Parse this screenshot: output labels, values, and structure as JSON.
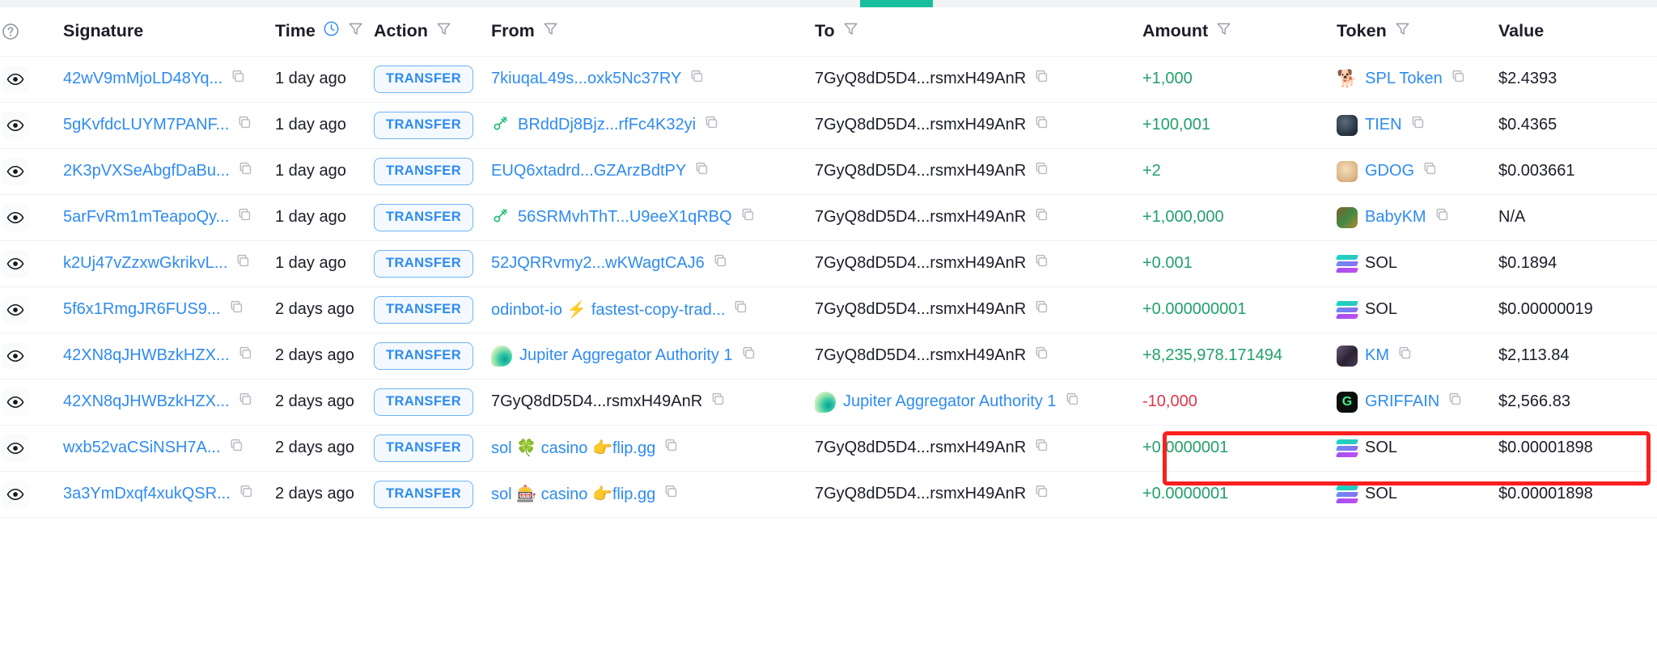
{
  "scrollbar": {
    "accent_color": "#17bf9e"
  },
  "table": {
    "columns": [
      {
        "key": "help",
        "label": "",
        "icon": "help-circle-icon",
        "filter": false
      },
      {
        "key": "signature",
        "label": "Signature",
        "filter": false
      },
      {
        "key": "time",
        "label": "Time",
        "filter": true,
        "icon": "clock-icon"
      },
      {
        "key": "action",
        "label": "Action",
        "filter": true
      },
      {
        "key": "from",
        "label": "From",
        "filter": true
      },
      {
        "key": "to",
        "label": "To",
        "filter": true
      },
      {
        "key": "amount",
        "label": "Amount",
        "filter": true
      },
      {
        "key": "token",
        "label": "Token",
        "filter": true
      },
      {
        "key": "value",
        "label": "Value",
        "filter": false
      }
    ],
    "rows": [
      {
        "signature": "42wV9mMjoLD48Yq...",
        "time": "1 day ago",
        "action": "TRANSFER",
        "from": {
          "text": "7kiuqaL49s...oxk5Nc37RY",
          "link": true,
          "icon": "none",
          "copy": true
        },
        "to": {
          "text": "7GyQ8dD5D4...rsmxH49AnR",
          "link": false,
          "icon": "none",
          "copy": true
        },
        "amount": "+1,000",
        "amount_sign": "positive",
        "token": {
          "label": "SPL Token",
          "icon": "dog-emoji",
          "copy": true,
          "link": true
        },
        "value": "$2.4393"
      },
      {
        "signature": "5gKvfdcLUYM7PANF...",
        "time": "1 day ago",
        "action": "TRANSFER",
        "from": {
          "text": "BRddDj8Bjz...rfFc4K32yi",
          "link": true,
          "icon": "green-key-icon",
          "copy": true
        },
        "to": {
          "text": "7GyQ8dD5D4...rsmxH49AnR",
          "link": false,
          "icon": "none",
          "copy": true
        },
        "amount": "+100,001",
        "amount_sign": "positive",
        "token": {
          "label": "TIEN",
          "icon": "tien-token-icon",
          "copy": true,
          "link": true
        },
        "value": "$0.4365"
      },
      {
        "signature": "2K3pVXSeAbgfDaBu...",
        "time": "1 day ago",
        "action": "TRANSFER",
        "from": {
          "text": "EUQ6xtadrd...GZArzBdtPY",
          "link": true,
          "icon": "none",
          "copy": true
        },
        "to": {
          "text": "7GyQ8dD5D4...rsmxH49AnR",
          "link": false,
          "icon": "none",
          "copy": true
        },
        "amount": "+2",
        "amount_sign": "positive",
        "token": {
          "label": "GDOG",
          "icon": "gdog-token-icon",
          "copy": true,
          "link": true
        },
        "value": "$0.003661"
      },
      {
        "signature": "5arFvRm1mTeapoQy...",
        "time": "1 day ago",
        "action": "TRANSFER",
        "from": {
          "text": "56SRMvhThT...U9eeX1qRBQ",
          "link": true,
          "icon": "green-key-icon",
          "copy": true
        },
        "to": {
          "text": "7GyQ8dD5D4...rsmxH49AnR",
          "link": false,
          "icon": "none",
          "copy": true
        },
        "amount": "+1,000,000",
        "amount_sign": "positive",
        "token": {
          "label": "BabyKM",
          "icon": "babykm-token-icon",
          "copy": true,
          "link": true
        },
        "value": "N/A"
      },
      {
        "signature": "k2Uj47vZzxwGkrikvL...",
        "time": "1 day ago",
        "action": "TRANSFER",
        "from": {
          "text": "52JQRRvmy2...wKWagtCAJ6",
          "link": true,
          "icon": "none",
          "copy": true
        },
        "to": {
          "text": "7GyQ8dD5D4...rsmxH49AnR",
          "link": false,
          "icon": "none",
          "copy": true
        },
        "amount": "+0.001",
        "amount_sign": "positive",
        "token": {
          "label": "SOL",
          "icon": "solana-token-icon",
          "copy": false,
          "link": false
        },
        "value": "$0.1894"
      },
      {
        "signature": "5f6x1RmgJR6FUS9...",
        "time": "2 days ago",
        "action": "TRANSFER",
        "from": {
          "text": "odinbot-io ⚡ fastest-copy-trad...",
          "link": true,
          "icon": "none",
          "copy": true
        },
        "to": {
          "text": "7GyQ8dD5D4...rsmxH49AnR",
          "link": false,
          "icon": "none",
          "copy": true
        },
        "amount": "+0.000000001",
        "amount_sign": "positive",
        "token": {
          "label": "SOL",
          "icon": "solana-token-icon",
          "copy": false,
          "link": false
        },
        "value": "$0.00000019"
      },
      {
        "signature": "42XN8qJHWBzkHZX...",
        "time": "2 days ago",
        "action": "TRANSFER",
        "from": {
          "text": "Jupiter Aggregator Authority 1",
          "link": true,
          "icon": "jupiter-icon",
          "copy": true
        },
        "to": {
          "text": "7GyQ8dD5D4...rsmxH49AnR",
          "link": false,
          "icon": "none",
          "copy": true
        },
        "amount": "+8,235,978.171494",
        "amount_sign": "positive",
        "token": {
          "label": "KM",
          "icon": "km-token-icon",
          "copy": true,
          "link": true
        },
        "value": "$2,113.84",
        "highlighted": true
      },
      {
        "signature": "42XN8qJHWBzkHZX...",
        "time": "2 days ago",
        "action": "TRANSFER",
        "from": {
          "text": "7GyQ8dD5D4...rsmxH49AnR",
          "link": false,
          "icon": "none",
          "copy": true
        },
        "to": {
          "text": "Jupiter Aggregator Authority 1",
          "link": true,
          "icon": "jupiter-icon",
          "copy": true
        },
        "amount": "-10,000",
        "amount_sign": "negative",
        "token": {
          "label": "GRIFFAIN",
          "icon": "griffain-token-icon",
          "copy": true,
          "link": true
        },
        "value": "$2,566.83"
      },
      {
        "signature": "wxb52vaCSiNSH7A...",
        "time": "2 days ago",
        "action": "TRANSFER",
        "from": {
          "text": "sol 🍀 casino 👉flip.gg",
          "link": true,
          "icon": "none",
          "copy": true
        },
        "to": {
          "text": "7GyQ8dD5D4...rsmxH49AnR",
          "link": false,
          "icon": "none",
          "copy": true
        },
        "amount": "+0.0000001",
        "amount_sign": "positive",
        "token": {
          "label": "SOL",
          "icon": "solana-token-icon",
          "copy": false,
          "link": false
        },
        "value": "$0.00001898"
      },
      {
        "signature": "3a3YmDxqf4xukQSR...",
        "time": "2 days ago",
        "action": "TRANSFER",
        "from": {
          "text": "sol 🎰 casino 👉flip.gg",
          "link": true,
          "icon": "none",
          "copy": true
        },
        "to": {
          "text": "7GyQ8dD5D4...rsmxH49AnR",
          "link": false,
          "icon": "none",
          "copy": true
        },
        "amount": "+0.0000001",
        "amount_sign": "positive",
        "token": {
          "label": "SOL",
          "icon": "solana-token-icon",
          "copy": false,
          "link": false
        },
        "value": "$0.00001898"
      }
    ]
  },
  "highlight": {
    "color": "#fb1f1f",
    "target_row_index": 6,
    "columns": [
      "amount",
      "token",
      "value"
    ]
  }
}
